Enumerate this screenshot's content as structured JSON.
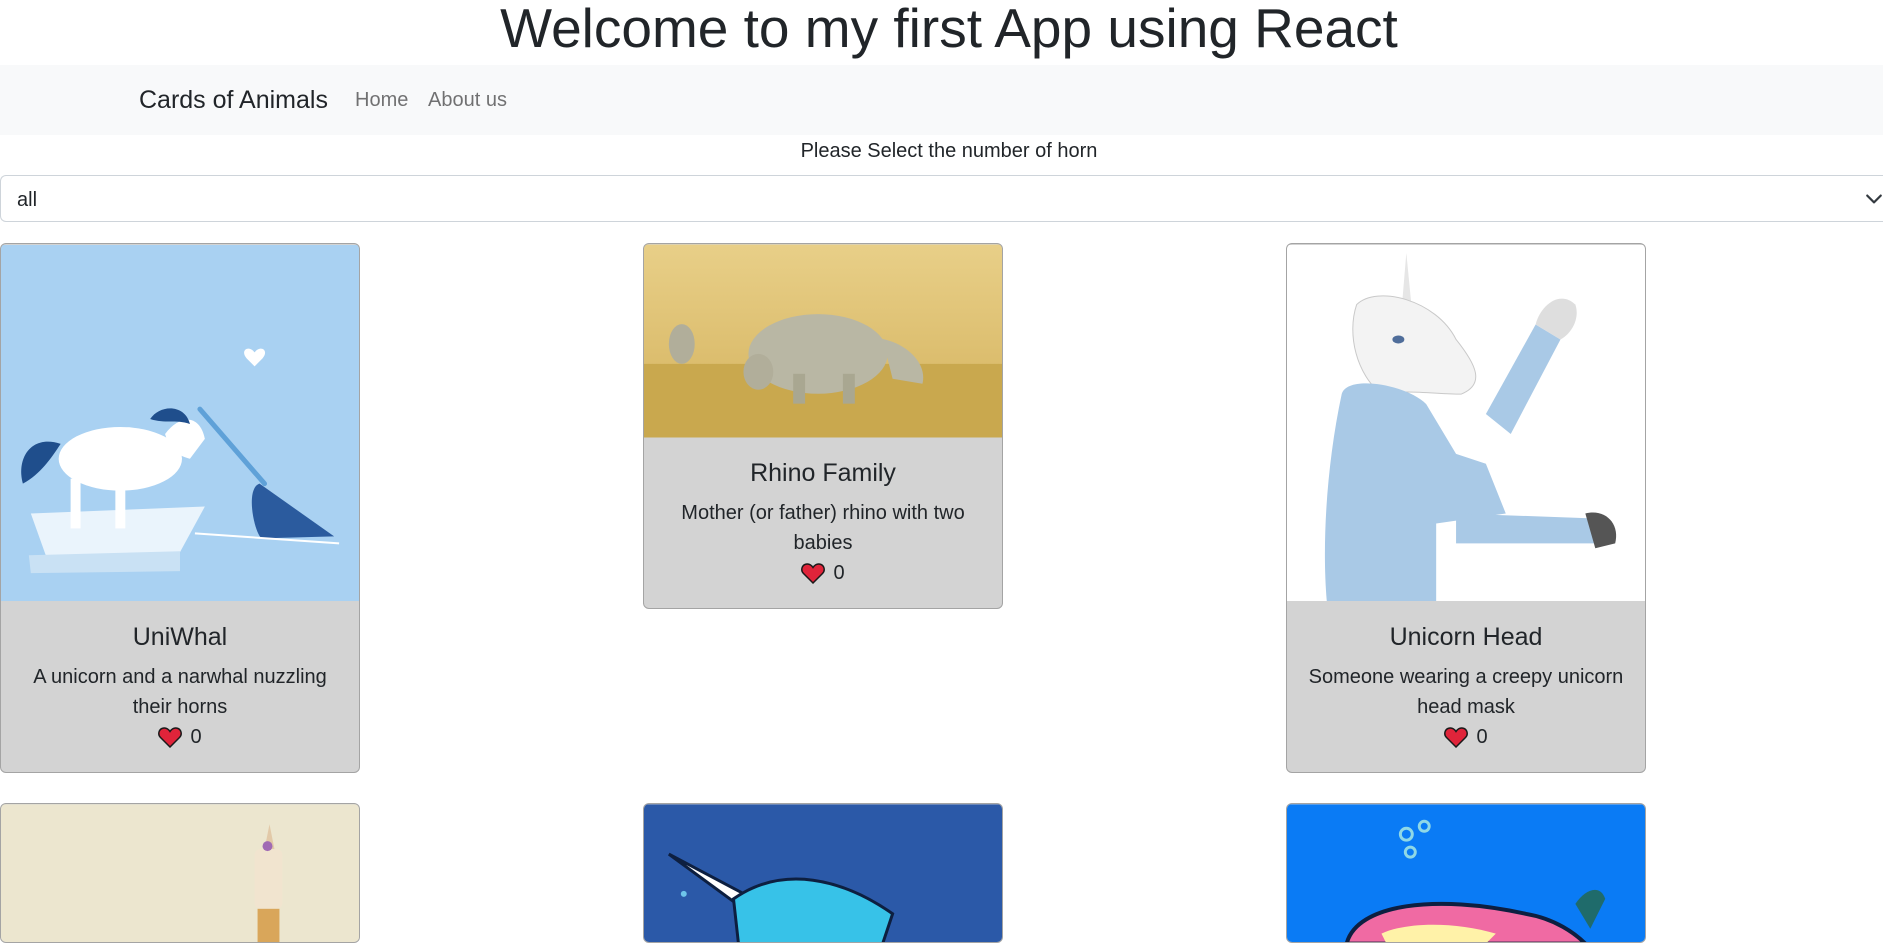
{
  "page": {
    "title": "Welcome to my first App using React"
  },
  "navbar": {
    "brand": "Cards of Animals",
    "links": [
      {
        "label": "Home"
      },
      {
        "label": "About us"
      }
    ]
  },
  "filter": {
    "label": "Please Select the number of horn",
    "selected": "all"
  },
  "cards": [
    {
      "title": "UniWhal",
      "description": "A unicorn and a narwhal nuzzling their horns",
      "likes": "0"
    },
    {
      "title": "Rhino Family",
      "description": "Mother (or father) rhino with two babies",
      "likes": "0"
    },
    {
      "title": "Unicorn Head",
      "description": "Someone wearing a creepy unicorn head mask",
      "likes": "0"
    }
  ],
  "colors": {
    "card_background": "#d3d3d3",
    "navbar_background": "#f8f9fa",
    "heart": "#e0243a"
  }
}
